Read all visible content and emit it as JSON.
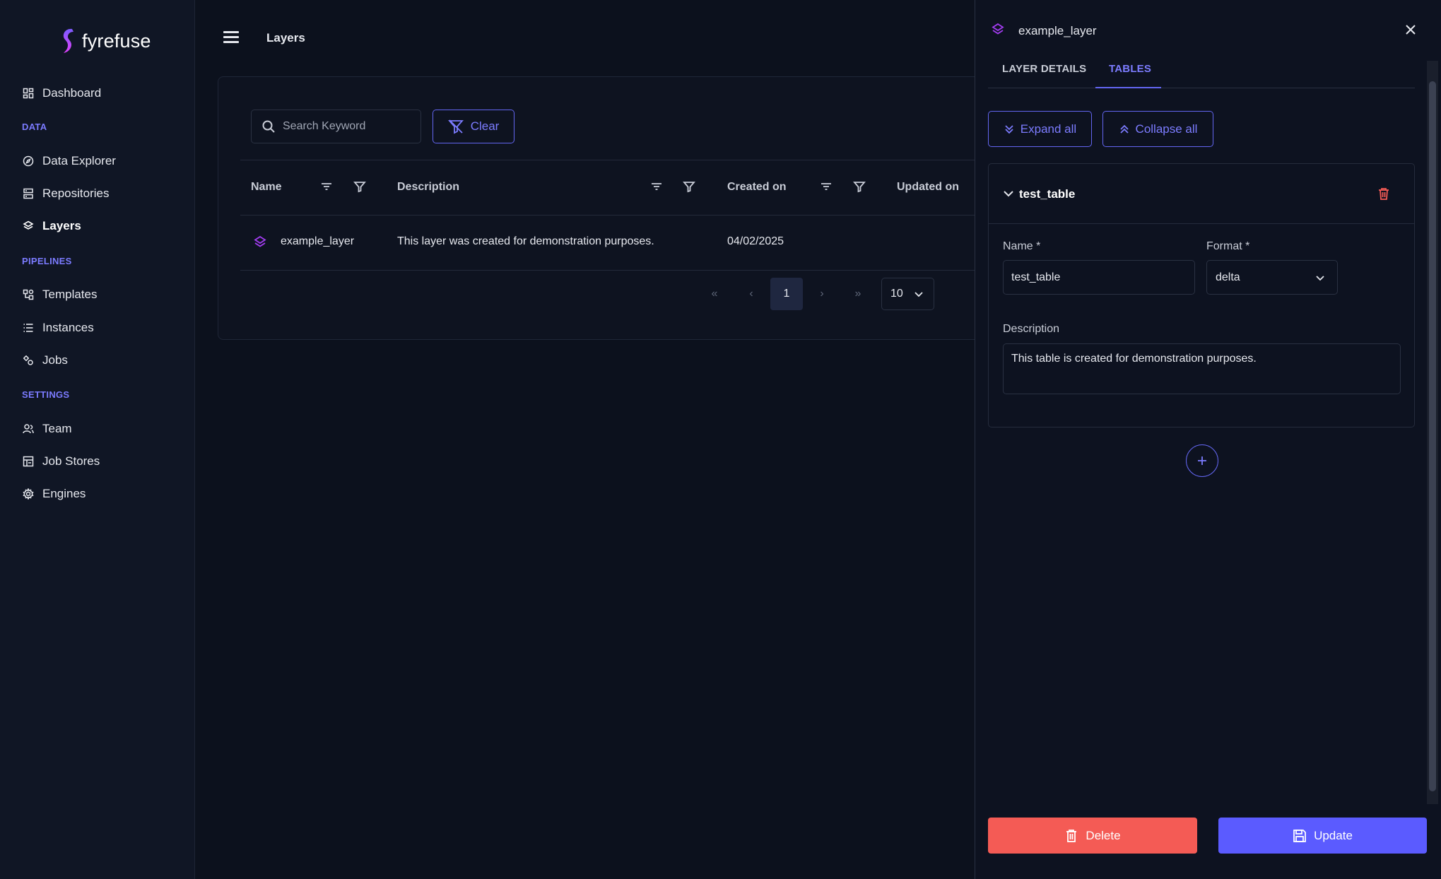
{
  "app": {
    "name": "fyrefuse"
  },
  "sidebar": {
    "dashboard": "Dashboard",
    "sections": {
      "data": "DATA",
      "pipelines": "PIPELINES",
      "settings": "SETTINGS"
    },
    "items": {
      "data_explorer": "Data Explorer",
      "repositories": "Repositories",
      "layers": "Layers",
      "templates": "Templates",
      "instances": "Instances",
      "jobs": "Jobs",
      "team": "Team",
      "job_stores": "Job Stores",
      "engines": "Engines"
    }
  },
  "header": {
    "title": "Layers"
  },
  "toolbar": {
    "search_placeholder": "Search Keyword",
    "clear_label": "Clear"
  },
  "table": {
    "columns": [
      "Name",
      "Description",
      "Created on",
      "Updated on"
    ],
    "rows": [
      {
        "name": "example_layer",
        "description": "This layer was created for demonstration purposes.",
        "created_on": "04/02/2025"
      }
    ]
  },
  "pagination": {
    "current_page": "1",
    "page_size": "10"
  },
  "drawer": {
    "title": "example_layer",
    "tabs": [
      "LAYER DETAILS",
      "TABLES"
    ],
    "active_tab": "TABLES",
    "expand_all": "Expand all",
    "collapse_all": "Collapse all",
    "table_item": {
      "name_header": "test_table",
      "name_label": "Name *",
      "name_value": "test_table",
      "format_label": "Format *",
      "format_value": "delta",
      "description_label": "Description",
      "description_value": "This table is created for demonstration purposes."
    },
    "delete_label": "Delete",
    "update_label": "Update"
  },
  "colors": {
    "accent": "#6366f1",
    "danger": "#f45b55",
    "background": "#0c111d"
  }
}
